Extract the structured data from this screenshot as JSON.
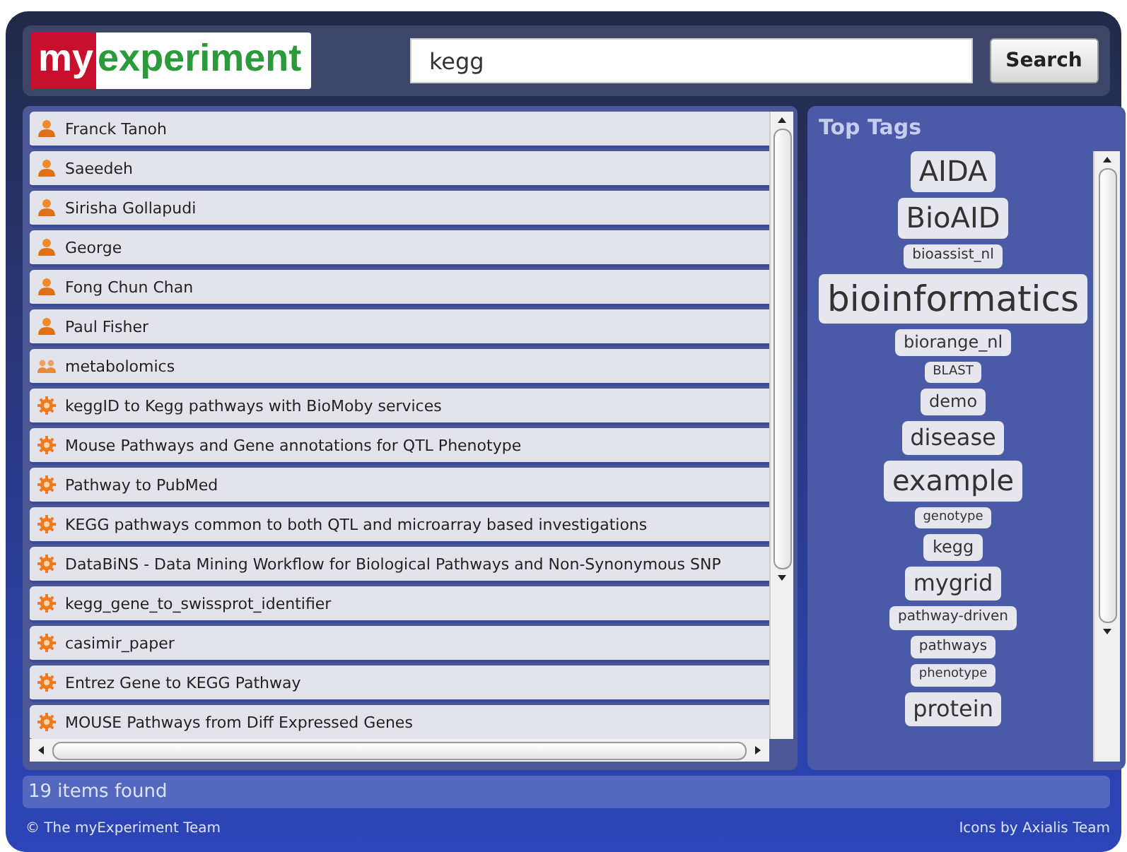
{
  "header": {
    "logo": {
      "part_1": "my",
      "part_2": "experiment"
    },
    "search": {
      "value": "kegg"
    },
    "search_button": "Search"
  },
  "results": [
    {
      "kind": "person",
      "label": "Franck Tanoh"
    },
    {
      "kind": "person",
      "label": "Saeedeh"
    },
    {
      "kind": "person",
      "label": "Sirisha Gollapudi"
    },
    {
      "kind": "person",
      "label": "George"
    },
    {
      "kind": "person",
      "label": "Fong Chun Chan"
    },
    {
      "kind": "person",
      "label": "Paul Fisher"
    },
    {
      "kind": "group",
      "label": "metabolomics"
    },
    {
      "kind": "workflow",
      "label": "keggID to Kegg pathways with BioMoby services"
    },
    {
      "kind": "workflow",
      "label": "Mouse Pathways and Gene annotations for QTL Phenotype"
    },
    {
      "kind": "workflow",
      "label": "Pathway to PubMed"
    },
    {
      "kind": "workflow",
      "label": "KEGG pathways common to both QTL and microarray based investigations"
    },
    {
      "kind": "workflow",
      "label": "DataBiNS - Data Mining Workflow for Biological Pathways and Non-Synonymous SNP"
    },
    {
      "kind": "workflow",
      "label": "kegg_gene_to_swissprot_identifier"
    },
    {
      "kind": "workflow",
      "label": "casimir_paper"
    },
    {
      "kind": "workflow",
      "label": "Entrez Gene to KEGG Pathway"
    },
    {
      "kind": "workflow",
      "label": "MOUSE Pathways from Diff Expressed Genes"
    }
  ],
  "top_tags": {
    "title": "Top Tags",
    "tags": [
      {
        "label": "AIDA",
        "kind": "large"
      },
      {
        "label": "BioAID",
        "kind": "large"
      },
      {
        "label": "bioassist_nl",
        "kind": "small"
      },
      {
        "label": "bioinformatics",
        "kind": "huge"
      },
      {
        "label": "biorange_nl",
        "kind": "normal"
      },
      {
        "label": "BLAST",
        "kind": "tiny"
      },
      {
        "label": "demo",
        "kind": "normal"
      },
      {
        "label": "disease",
        "kind": "medium"
      },
      {
        "label": "example",
        "kind": "large"
      },
      {
        "label": "genotype",
        "kind": "tiny"
      },
      {
        "label": "kegg",
        "kind": "normal"
      },
      {
        "label": "mygrid",
        "kind": "medium"
      },
      {
        "label": "pathway-driven",
        "kind": "small"
      },
      {
        "label": "pathways",
        "kind": "small"
      },
      {
        "label": "phenotype",
        "kind": "tiny"
      },
      {
        "label": "protein",
        "kind": "medium"
      }
    ]
  },
  "status_bar": "19 items found",
  "footer": {
    "left": "© The myExperiment Team",
    "right": "Icons by Axialis Team"
  }
}
